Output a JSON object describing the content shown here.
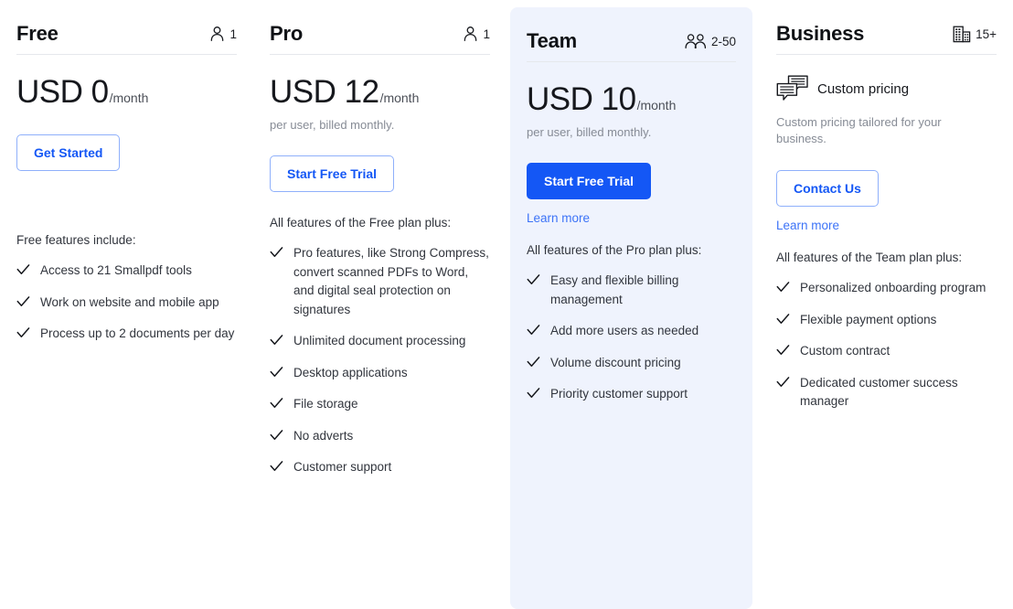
{
  "colors": {
    "accent": "#1457f5",
    "accent_light_border": "#8fb0fb",
    "highlight_card_bg": "#eff3fd",
    "text_primary": "#16181d",
    "text_muted": "#868b95",
    "divider": "#e6e8ec"
  },
  "plans": [
    {
      "id": "free",
      "name": "Free",
      "seat_icon": "single-person-icon",
      "seat_count": "1",
      "highlighted": false,
      "price_main": "USD 0",
      "price_period": "/month",
      "price_note": "",
      "cta_label": "Get Started",
      "cta_style": "outline",
      "learn_more": "",
      "features_intro": "Free features include:",
      "features": [
        "Access to 21 Smallpdf tools",
        "Work on website and mobile app",
        "Process up to 2 documents per day"
      ]
    },
    {
      "id": "pro",
      "name": "Pro",
      "seat_icon": "single-person-icon",
      "seat_count": "1",
      "highlighted": false,
      "price_main": "USD 12",
      "price_period": "/month",
      "price_note": "per user, billed monthly.",
      "cta_label": "Start Free Trial",
      "cta_style": "outline",
      "learn_more": "",
      "features_intro": "All features of the Free plan plus:",
      "features": [
        "Pro features, like Strong Compress, convert scanned PDFs to Word, and digital seal protection on signatures",
        "Unlimited document processing",
        "Desktop applications",
        "File storage",
        "No adverts",
        "Customer support"
      ]
    },
    {
      "id": "team",
      "name": "Team",
      "seat_icon": "two-people-icon",
      "seat_count": "2-50",
      "highlighted": true,
      "price_main": "USD 10",
      "price_period": "/month",
      "price_note": "per user, billed monthly.",
      "cta_label": "Start Free Trial",
      "cta_style": "filled",
      "learn_more": "Learn more",
      "features_intro": "All features of the Pro plan plus:",
      "features": [
        "Easy and flexible billing management",
        "Add more users as needed",
        "Volume discount pricing",
        "Priority customer support"
      ]
    },
    {
      "id": "business",
      "name": "Business",
      "seat_icon": "building-icon",
      "seat_count": "15+",
      "highlighted": false,
      "custom_pricing_icon": "chat-bubbles-icon",
      "custom_pricing_label": "Custom pricing",
      "custom_pricing_desc": "Custom pricing tailored for your business.",
      "cta_label": "Contact Us",
      "cta_style": "outline",
      "learn_more": "Learn more",
      "features_intro": "All features of the Team plan plus:",
      "features": [
        "Personalized onboarding program",
        "Flexible payment options",
        "Custom contract",
        "Dedicated customer success manager"
      ]
    }
  ]
}
